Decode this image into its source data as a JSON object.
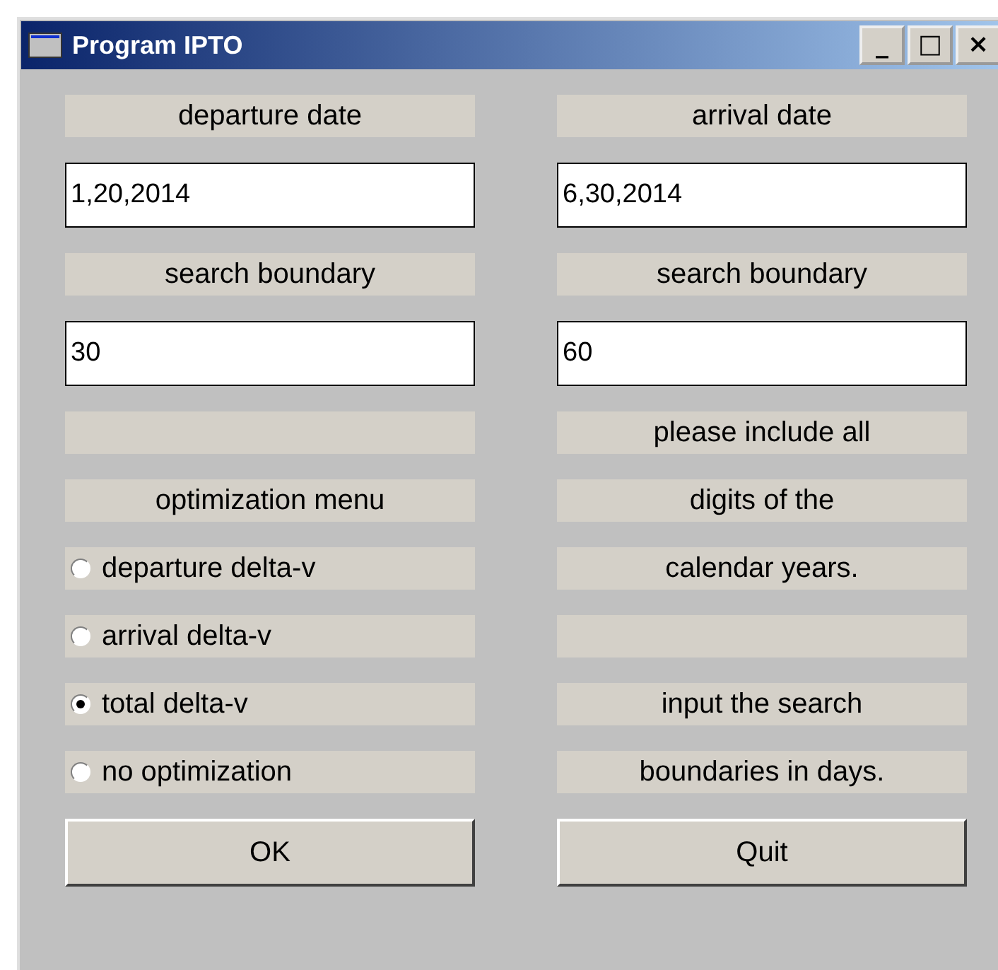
{
  "window": {
    "title": "Program IPTO",
    "controls": [
      "_",
      "□",
      "×"
    ]
  },
  "left_column": [
    {
      "kind": "label",
      "text": "departure date"
    },
    {
      "kind": "field",
      "value": "1,20,2014"
    },
    {
      "kind": "label",
      "text": "search boundary"
    },
    {
      "kind": "field",
      "value": "30"
    },
    {
      "kind": "blank"
    },
    {
      "kind": "label",
      "text": "optimization menu"
    },
    {
      "kind": "radio",
      "text": "departure delta-v",
      "selected": false
    },
    {
      "kind": "radio",
      "text": "arrival delta-v",
      "selected": false
    },
    {
      "kind": "radio",
      "text": "total delta-v",
      "selected": true
    },
    {
      "kind": "radio",
      "text": "no optimization",
      "selected": false
    },
    {
      "kind": "button",
      "text": "OK"
    }
  ],
  "right_column": [
    {
      "kind": "label",
      "text": "arrival date"
    },
    {
      "kind": "field",
      "value": "6,30,2014"
    },
    {
      "kind": "label",
      "text": "search boundary"
    },
    {
      "kind": "field",
      "value": "60"
    },
    {
      "kind": "label",
      "text": "please include all"
    },
    {
      "kind": "label",
      "text": "digits of the"
    },
    {
      "kind": "label",
      "text": "calendar years."
    },
    {
      "kind": "blank"
    },
    {
      "kind": "label",
      "text": "input the search"
    },
    {
      "kind": "label",
      "text": "boundaries in days."
    },
    {
      "kind": "button",
      "text": "Quit"
    }
  ]
}
